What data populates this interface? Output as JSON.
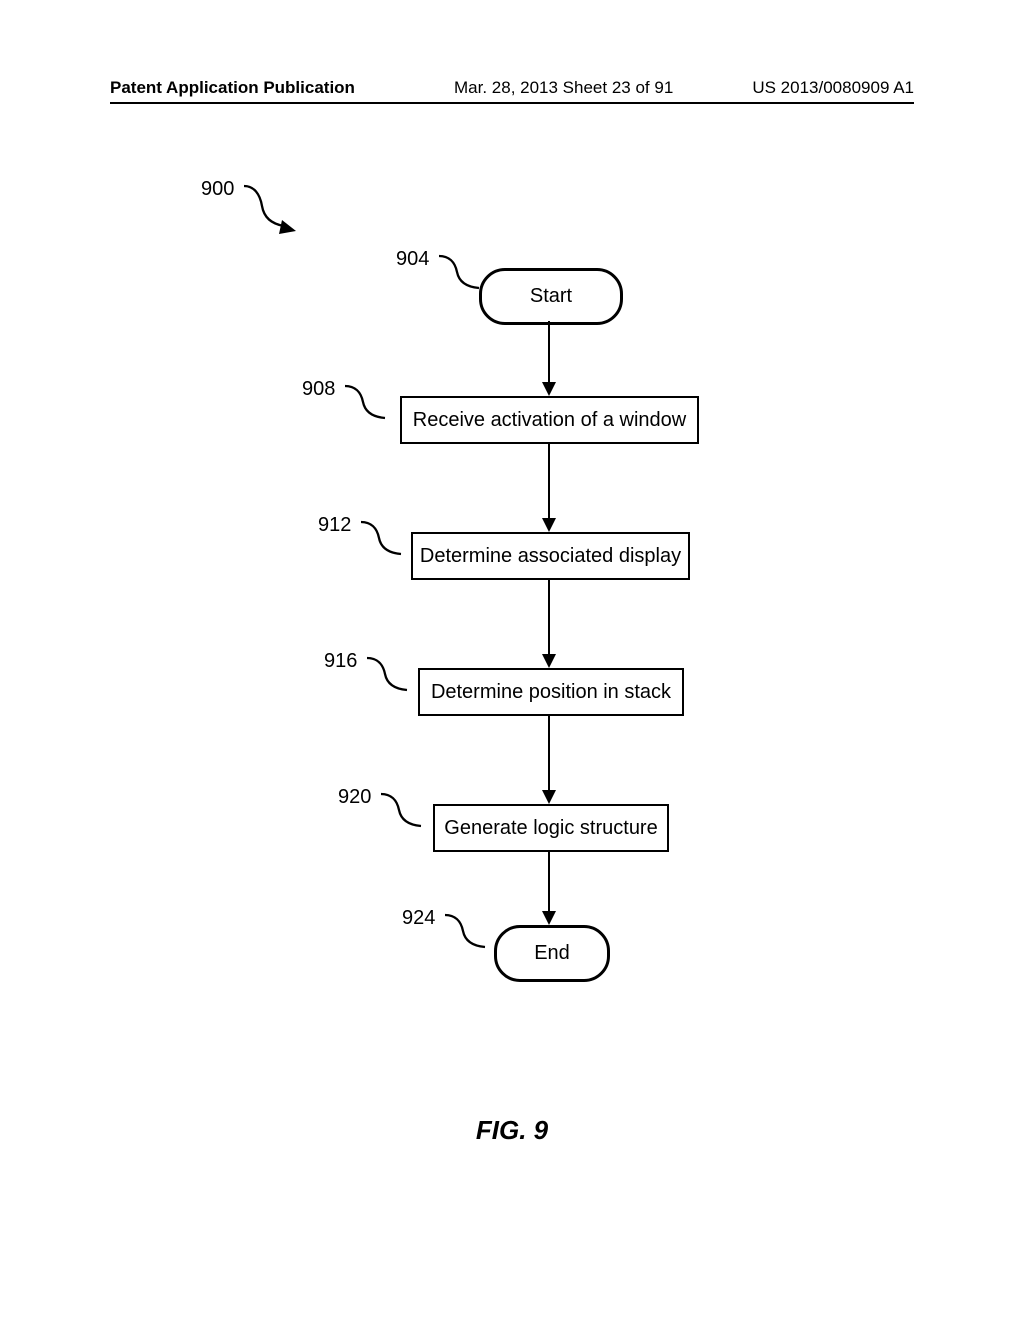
{
  "header": {
    "left": "Patent Application Publication",
    "mid": "Mar. 28, 2013  Sheet 23 of 91",
    "right": "US 2013/0080909 A1"
  },
  "figure_label": "FIG. 9",
  "flow": {
    "overall_ref": "900",
    "start": {
      "ref": "904",
      "label": "Start"
    },
    "step1": {
      "ref": "908",
      "label": "Receive activation of a window"
    },
    "step2": {
      "ref": "912",
      "label": "Determine associated display"
    },
    "step3": {
      "ref": "916",
      "label": "Determine position in stack"
    },
    "step4": {
      "ref": "920",
      "label": "Generate logic structure"
    },
    "end": {
      "ref": "924",
      "label": "End"
    }
  }
}
